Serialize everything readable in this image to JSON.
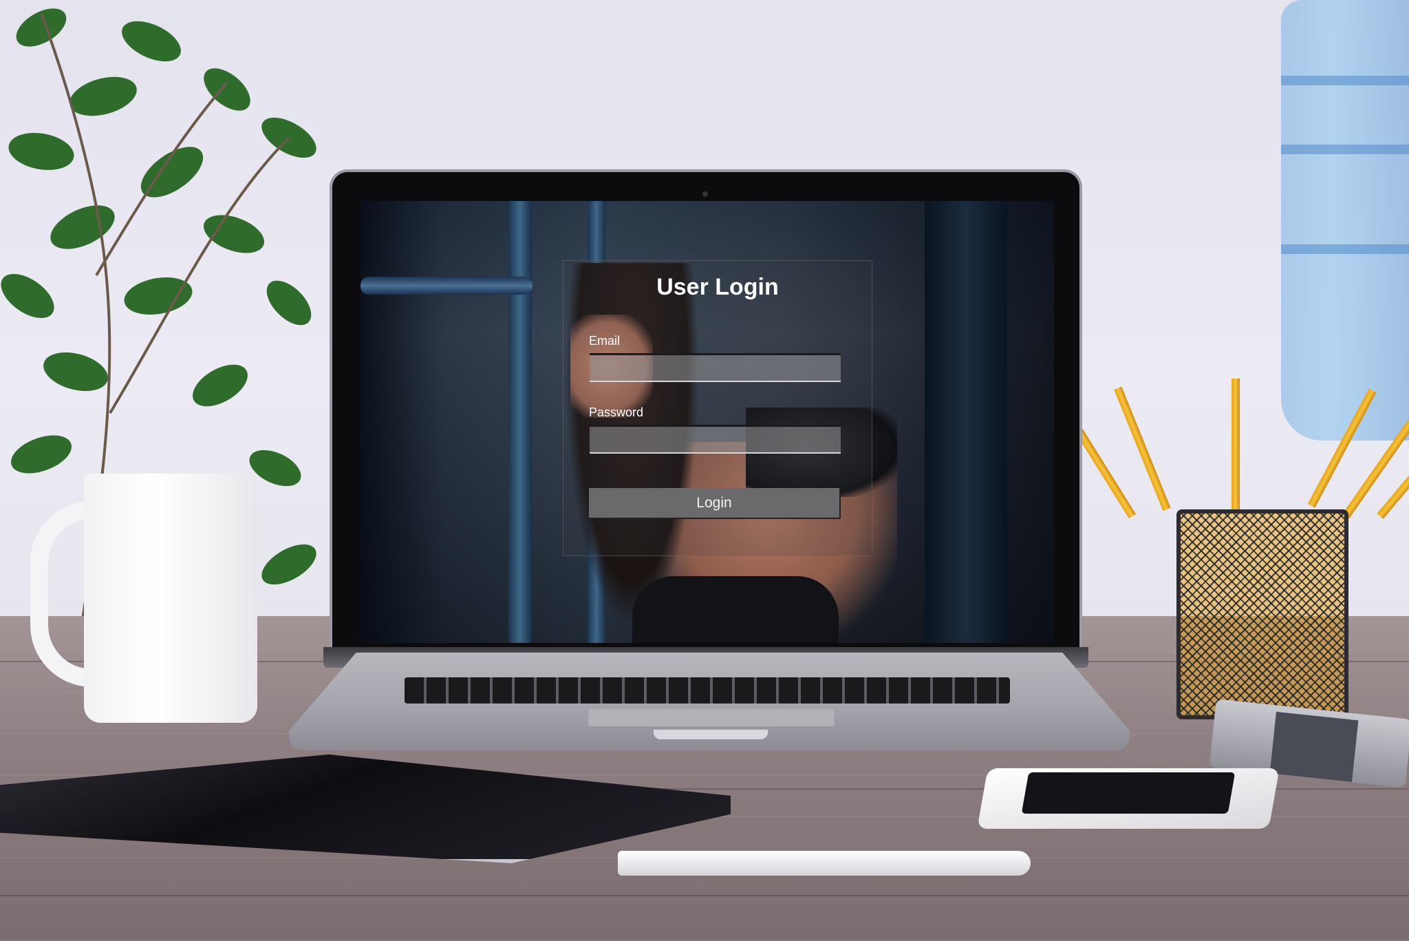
{
  "login_form": {
    "title": "User Login",
    "email_label": "Email",
    "email_value": "",
    "password_label": "Password",
    "password_value": "",
    "login_button": "Login"
  },
  "icons": [
    "webcam-icon"
  ],
  "colors": {
    "button_bg": "#6a6a6c",
    "title_text": "#ffffff",
    "input_bg": "#969698"
  }
}
